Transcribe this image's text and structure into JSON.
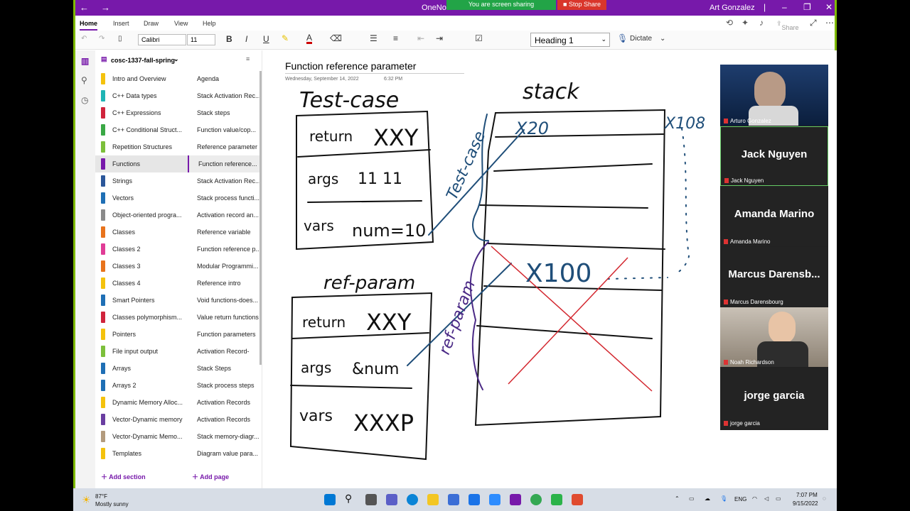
{
  "titlebar": {
    "app_title": "OneNote",
    "user": "Art Gonzalez",
    "back_glyph": "←",
    "forward_glyph": "→"
  },
  "sharebar": {
    "sharing": "You are screen sharing",
    "stop": "Stop Share"
  },
  "ribbon": {
    "tabs": [
      "Home",
      "Insert",
      "Draw",
      "View",
      "Help"
    ],
    "share_label": "Share"
  },
  "toolbar": {
    "font": "Calibri",
    "size": "11",
    "heading_style": "Heading 1",
    "dictate": "Dictate"
  },
  "notebook": {
    "name": "cosc-1337-fall-spring"
  },
  "sections": [
    {
      "label": "Intro and Overview",
      "color": "#f4c20d"
    },
    {
      "label": "C++ Data types",
      "color": "#1fb5b5"
    },
    {
      "label": "C++ Expressions",
      "color": "#d0243c"
    },
    {
      "label": "C++ Conditional Struct...",
      "color": "#3aa845"
    },
    {
      "label": "Repetition Structures",
      "color": "#7cbf3b"
    },
    {
      "label": "Functions",
      "color": "#7719aa"
    },
    {
      "label": "Strings",
      "color": "#2b579a"
    },
    {
      "label": "Vectors",
      "color": "#1f6fb5"
    },
    {
      "label": "Object-oriented progra...",
      "color": "#8a8a8a"
    },
    {
      "label": "Classes",
      "color": "#e8731c"
    },
    {
      "label": "Classes 2",
      "color": "#e03c96"
    },
    {
      "label": "Classes 3",
      "color": "#e8731c"
    },
    {
      "label": "Classes 4",
      "color": "#f4c20d"
    },
    {
      "label": "Smart Pointers",
      "color": "#1f6fb5"
    },
    {
      "label": "Classes polymorphism...",
      "color": "#d0243c"
    },
    {
      "label": "Pointers",
      "color": "#f4c20d"
    },
    {
      "label": "File input output",
      "color": "#7cbf3b"
    },
    {
      "label": "Arrays",
      "color": "#1f6fb5"
    },
    {
      "label": "Arrays 2",
      "color": "#1f6fb5"
    },
    {
      "label": "Dynamic Memory Alloc...",
      "color": "#f4c20d"
    },
    {
      "label": "Vector-Dynamic memory",
      "color": "#6a3ea1"
    },
    {
      "label": "Vector-Dynamic Memo...",
      "color": "#b39b7d"
    },
    {
      "label": "Templates",
      "color": "#f4c20d"
    }
  ],
  "pages": [
    "Agenda",
    "Stack Activation Rec...",
    "Stack steps",
    "Function value/cop...",
    "Reference parameter",
    "Function reference...",
    "Stack Activation Rec...",
    "Stack process functi...",
    "Activation record an...",
    "Reference variable",
    "Function reference p...",
    "Modular Programmi...",
    "Reference intro",
    "Void functions-does...",
    "Value return functions",
    "Function parameters",
    "Activation Record-",
    "Stack Steps",
    "Stack process steps",
    "Activation Records",
    "Activation Records",
    "Stack memory-diagr...",
    "Diagram value para..."
  ],
  "add_section": "Add section",
  "add_page": "Add page",
  "page": {
    "title": "Function reference parameter",
    "date": "Wednesday, September 14, 2022",
    "time": "6:32 PM"
  },
  "ink": {
    "test_case": "Test-case",
    "stack": "stack",
    "return1": "return",
    "xxy1": "XXY",
    "args1": "args",
    "args_vals": "11     11",
    "vars1": "vars",
    "num10": "num=10",
    "ref_param": "ref-param",
    "return2": "return",
    "xxy2": "XXY",
    "args2": "args",
    "anum": "&num",
    "vars2": "vars",
    "xxxp": "XXXP",
    "x20": "X20",
    "x108": "X108",
    "x100": "X100",
    "side_test_case": "Test-case",
    "side_ref_param": "ref-param"
  },
  "participants": [
    {
      "name": "Arturo Gonzalez",
      "video": true
    },
    {
      "name": "Jack Nguyen",
      "video": false
    },
    {
      "name": "Amanda Marino",
      "video": false
    },
    {
      "name": "Marcus  Darensbourg",
      "short": "Marcus  Darensb...",
      "video": false
    },
    {
      "name": "Noah Richardson",
      "video": true
    },
    {
      "name": "jorge garcia",
      "video": false
    }
  ],
  "taskbar": {
    "weather_temp": "87°F",
    "weather_desc": "Mostly sunny",
    "lang": "ENG",
    "time": "7:07 PM",
    "date": "9/15/2022"
  }
}
